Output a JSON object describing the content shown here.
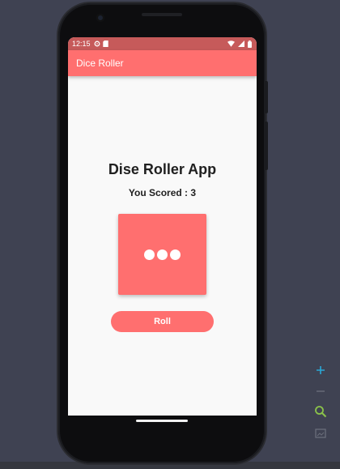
{
  "status_bar": {
    "time": "12:15"
  },
  "app_bar": {
    "title": "Dice Roller"
  },
  "main": {
    "heading": "Dise Roller App",
    "score_text": "You Scored : 3",
    "dice_value": 3,
    "roll_label": "Roll"
  },
  "colors": {
    "accent": "#ff6f6f",
    "status_bar": "#c65a5a",
    "background": "#f9f9f9"
  },
  "emulator_toolbar": [
    "zoom-in-icon",
    "zoom-out-icon",
    "zoom-fit-icon",
    "screenshot-icon"
  ]
}
